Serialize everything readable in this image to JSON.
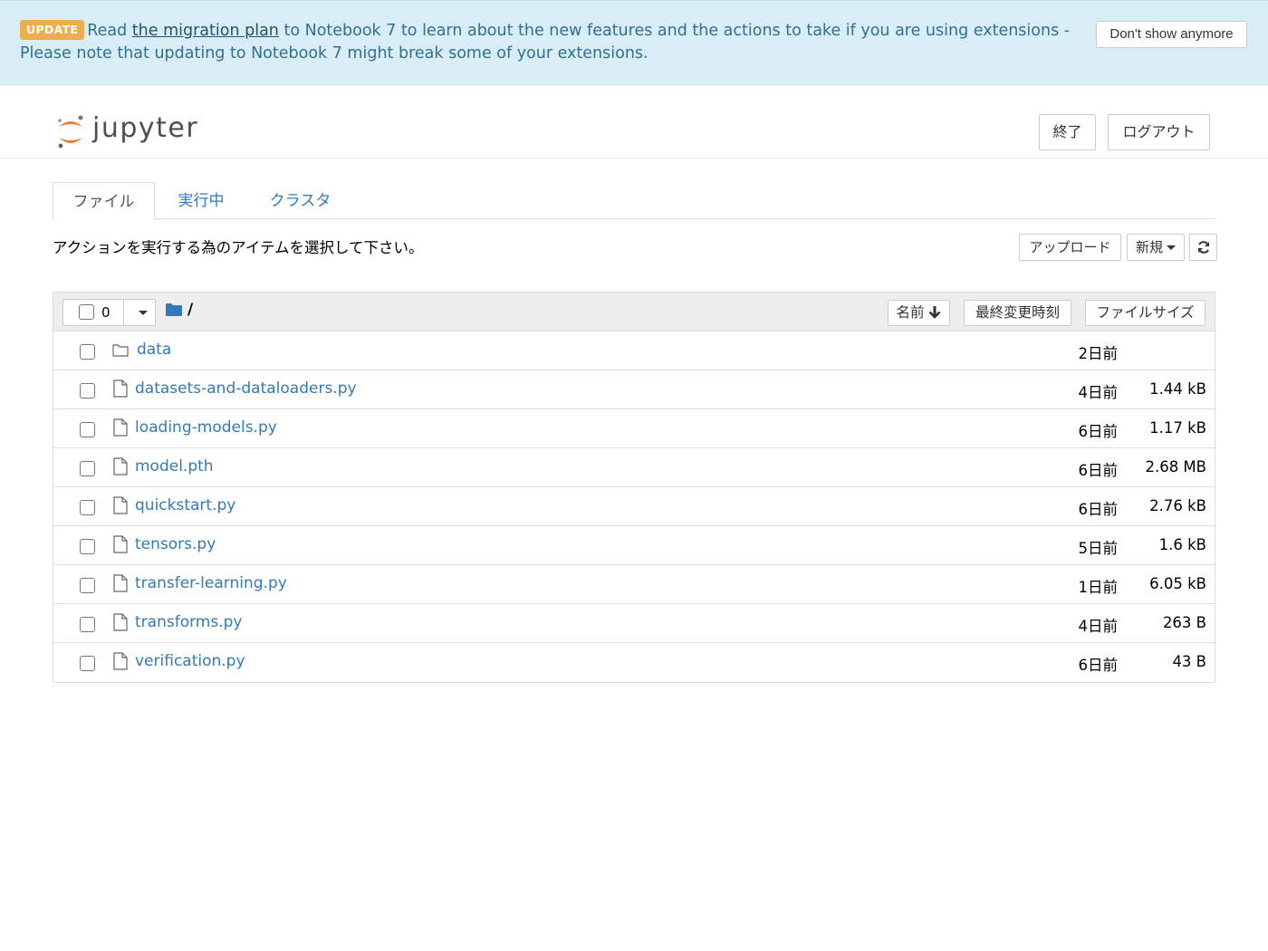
{
  "banner": {
    "badge": "UPDATE",
    "text_before": "Read ",
    "link": "the migration plan",
    "text_after": " to Notebook 7 to learn about the new features and the actions to take if you are using extensions - Please note that updating to Notebook 7 might break some of your extensions.",
    "dismiss_label": "Don't show anymore",
    "color": "#d9edf7"
  },
  "header": {
    "logo_text": "jupyter",
    "quit_label": "終了",
    "logout_label": "ログアウト"
  },
  "tabs": [
    {
      "label": "ファイル",
      "active": true
    },
    {
      "label": "実行中",
      "active": false
    },
    {
      "label": "クラスタ",
      "active": false
    }
  ],
  "toolbar": {
    "instruction": "アクションを実行する為のアイテムを選択して下さい。",
    "upload_label": "アップロード",
    "new_label": "新規",
    "refresh_icon": "refresh-icon"
  },
  "list_header": {
    "selected_count": "0",
    "path": "/",
    "sort_name_label": "名前",
    "sort_modified_label": "最終変更時刻",
    "sort_size_label": "ファイルサイズ"
  },
  "files": [
    {
      "name": "data",
      "type": "folder",
      "modified": "2日前",
      "size": ""
    },
    {
      "name": "datasets-and-dataloaders.py",
      "type": "file",
      "modified": "4日前",
      "size": "1.44 kB"
    },
    {
      "name": "loading-models.py",
      "type": "file",
      "modified": "6日前",
      "size": "1.17 kB"
    },
    {
      "name": "model.pth",
      "type": "file",
      "modified": "6日前",
      "size": "2.68 MB"
    },
    {
      "name": "quickstart.py",
      "type": "file",
      "modified": "6日前",
      "size": "2.76 kB"
    },
    {
      "name": "tensors.py",
      "type": "file",
      "modified": "5日前",
      "size": "1.6 kB"
    },
    {
      "name": "transfer-learning.py",
      "type": "file",
      "modified": "1日前",
      "size": "6.05 kB"
    },
    {
      "name": "transforms.py",
      "type": "file",
      "modified": "4日前",
      "size": "263 B"
    },
    {
      "name": "verification.py",
      "type": "file",
      "modified": "6日前",
      "size": "43 B"
    }
  ]
}
